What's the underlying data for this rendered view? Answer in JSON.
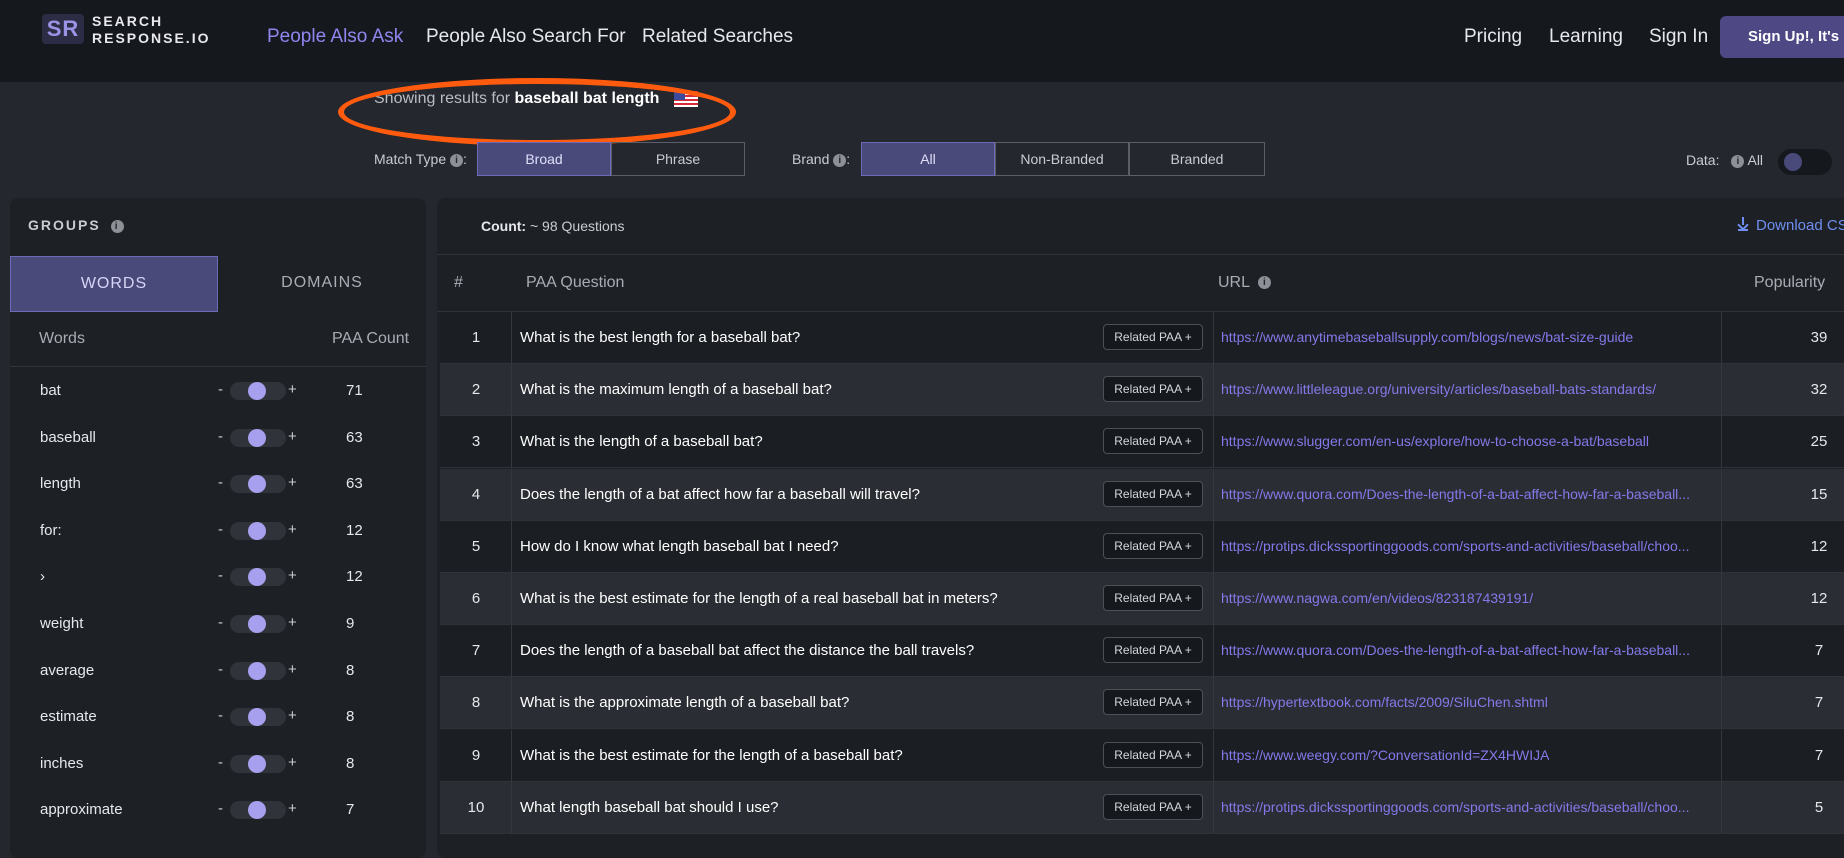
{
  "nav": {
    "logo_mark": "SR",
    "logo_line1": "SEARCH",
    "logo_line2": "RESPONSE.IO",
    "links": [
      "People Also Ask",
      "People Also Search For",
      "Related Searches"
    ],
    "right_links": [
      "Pricing",
      "Learning",
      "Sign In"
    ],
    "signup": "Sign Up!, It's Fr"
  },
  "showing": {
    "prefix": "Showing results for",
    "query": "baseball bat length"
  },
  "filters": {
    "match_type_label": "Match Type",
    "match_options": [
      "Broad",
      "Phrase"
    ],
    "brand_label": "Brand",
    "brand_options": [
      "All",
      "Non-Branded",
      "Branded"
    ],
    "data_label": "Data:",
    "data_option": "All"
  },
  "groups": {
    "title": "GROUPS",
    "tabs": [
      "WORDS",
      "DOMAINS"
    ],
    "col_words": "Words",
    "col_count": "PAA Count",
    "words": [
      {
        "word": "bat",
        "count": "71"
      },
      {
        "word": "baseball",
        "count": "63"
      },
      {
        "word": "length",
        "count": "63"
      },
      {
        "word": "for:",
        "count": "12"
      },
      {
        "word": "›",
        "count": "12"
      },
      {
        "word": "weight",
        "count": "9"
      },
      {
        "word": "average",
        "count": "8"
      },
      {
        "word": "estimate",
        "count": "8"
      },
      {
        "word": "inches",
        "count": "8"
      },
      {
        "word": "approximate",
        "count": "7"
      }
    ],
    "minus": "-",
    "plus": "+"
  },
  "results": {
    "count_label": "Count:",
    "count_value": "~ 98 Questions",
    "download": "Download CS",
    "headers": {
      "num": "#",
      "question": "PAA Question",
      "url": "URL",
      "popularity": "Popularity"
    },
    "related_label": "Related PAA +",
    "rows": [
      {
        "n": "1",
        "q": "What is the best length for a baseball bat?",
        "url": "https://www.anytimebaseballsupply.com/blogs/news/bat-size-guide",
        "pop": "39"
      },
      {
        "n": "2",
        "q": "What is the maximum length of a baseball bat?",
        "url": "https://www.littleleague.org/university/articles/baseball-bats-standards/",
        "pop": "32"
      },
      {
        "n": "3",
        "q": "What is the length of a baseball bat?",
        "url": "https://www.slugger.com/en-us/explore/how-to-choose-a-bat/baseball",
        "pop": "25"
      },
      {
        "n": "4",
        "q": "Does the length of a bat affect how far a baseball will travel?",
        "url": "https://www.quora.com/Does-the-length-of-a-bat-affect-how-far-a-baseball...",
        "pop": "15"
      },
      {
        "n": "5",
        "q": "How do I know what length baseball bat I need?",
        "url": "https://protips.dickssportinggoods.com/sports-and-activities/baseball/choo...",
        "pop": "12"
      },
      {
        "n": "6",
        "q": "What is the best estimate for the length of a real baseball bat in meters?",
        "url": "https://www.nagwa.com/en/videos/823187439191/",
        "pop": "12"
      },
      {
        "n": "7",
        "q": "Does the length of a baseball bat affect the distance the ball travels?",
        "url": "https://www.quora.com/Does-the-length-of-a-bat-affect-how-far-a-baseball...",
        "pop": "7"
      },
      {
        "n": "8",
        "q": "What is the approximate length of a baseball bat?",
        "url": "https://hypertextbook.com/facts/2009/SiluChen.shtml",
        "pop": "7"
      },
      {
        "n": "9",
        "q": "What is the best estimate for the length of a baseball bat?",
        "url": "https://www.weegy.com/?ConversationId=ZX4HWIJA",
        "pop": "7"
      },
      {
        "n": "10",
        "q": "What length baseball bat should I use?",
        "url": "https://protips.dickssportinggoods.com/sports-and-activities/baseball/choo...",
        "pop": "5"
      }
    ]
  },
  "colors": {
    "accent": "#8f86f0",
    "annotation": "#ff5b0f",
    "selected": "#4a4a7a"
  }
}
